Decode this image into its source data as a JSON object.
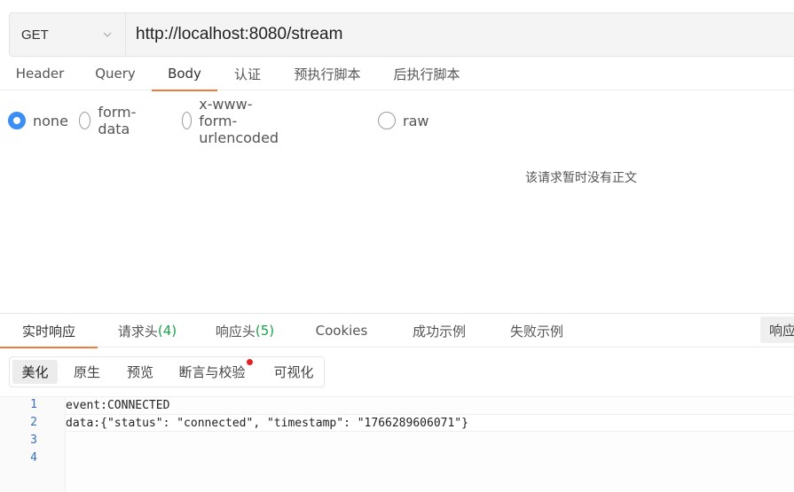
{
  "request": {
    "method": "GET",
    "url": "http://localhost:8080/stream"
  },
  "req_tabs": [
    {
      "label": "Header"
    },
    {
      "label": "Query"
    },
    {
      "label": "Body"
    },
    {
      "label": "认证"
    },
    {
      "label": "预执行脚本"
    },
    {
      "label": "后执行脚本"
    }
  ],
  "active_req_tab": "Body",
  "body_types": [
    {
      "label": "none",
      "checked": true
    },
    {
      "label": "form-data",
      "checked": false
    },
    {
      "label": "x-www-form-urlencoded",
      "checked": false
    },
    {
      "label": "raw",
      "checked": false
    }
  ],
  "no_body_text": "该请求暂时没有正文",
  "resp_tabs": [
    {
      "label": "实时响应",
      "count": ""
    },
    {
      "label": "请求头",
      "count": "(4)"
    },
    {
      "label": "响应头",
      "count": "(5)"
    },
    {
      "label": "Cookies",
      "count": ""
    },
    {
      "label": "成功示例",
      "count": ""
    },
    {
      "label": "失败示例",
      "count": ""
    }
  ],
  "resp_right_button": "响应",
  "view_modes": [
    {
      "label": "美化",
      "active": true
    },
    {
      "label": "原生",
      "active": false
    },
    {
      "label": "预览",
      "active": false
    },
    {
      "label": "断言与校验",
      "active": false,
      "badge": true
    },
    {
      "label": "可视化",
      "active": false
    }
  ],
  "code_lines": [
    {
      "num": "1",
      "text": "event:CONNECTED"
    },
    {
      "num": "2",
      "text": "data:{\"status\": \"connected\", \"timestamp\": \"1766289606071\"}"
    },
    {
      "num": "3",
      "text": ""
    },
    {
      "num": "4",
      "text": ""
    }
  ],
  "colors": {
    "accent": "#f07b3f",
    "radio_checked": "#3a8ef6",
    "count_green": "#1aa34a",
    "badge_red": "#e02424",
    "line_number": "#3b6fb6"
  },
  "icons": {
    "method_dropdown": "chevron-down-icon"
  }
}
